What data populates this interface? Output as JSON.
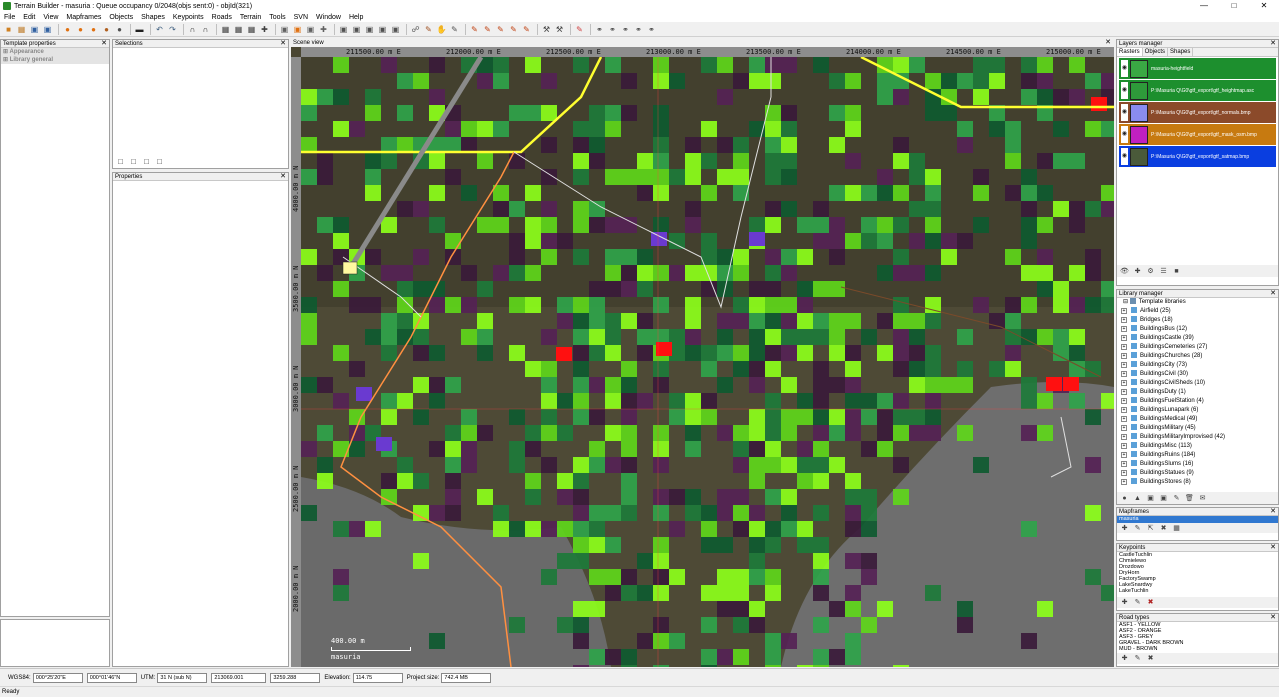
{
  "window": {
    "title": "Terrain Builder - masuria : Queue occupancy 0/2048(objs sent:0) - objId(321)"
  },
  "menu": [
    "File",
    "Edit",
    "View",
    "Mapframes",
    "Objects",
    "Shapes",
    "Keypoints",
    "Roads",
    "Terrain",
    "Tools",
    "SVN",
    "Window",
    "Help"
  ],
  "panels": {
    "template_properties": {
      "title": "Template properties",
      "rows": [
        "Appearance",
        "Library general"
      ]
    },
    "selections": {
      "title": "Selections"
    },
    "properties": {
      "title": "Properties"
    },
    "scene_view": {
      "title": "Scene view"
    },
    "layers_manager": {
      "title": "Layers manager",
      "tabs": [
        "Rasters",
        "Objects",
        "Shapes"
      ]
    },
    "library_manager": {
      "title": "Library manager"
    },
    "mapframes": {
      "title": "Mapframes",
      "selected": "masuria"
    },
    "keypoints": {
      "title": "Keypoints"
    },
    "road_types": {
      "title": "Road types"
    }
  },
  "scene": {
    "x_ticks": [
      "211500.00 m E",
      "212000.00 m E",
      "212500.00 m E",
      "213000.00 m E",
      "213500.00 m E",
      "214000.00 m E",
      "214500.00 m E",
      "215000.00 m E"
    ],
    "y_ticks": [
      "4000.00 m N",
      "3500.00 m N",
      "3000.00 m N",
      "2500.00 m N",
      "2000.00 m N"
    ],
    "scale_label": "400.00 m",
    "map_name": "masuria"
  },
  "layers": [
    {
      "label": "masuria-heightfield",
      "bg": "#1d8f2e",
      "thumb": "#3aa844"
    },
    {
      "label": "P:\\Masuria Q\\G0\\gtf_export\\gtf_heightmap.asc",
      "bg": "#1d8f2e",
      "thumb": "#2e9a3a"
    },
    {
      "label": "P:\\Masuria Q\\G0\\gtf_export\\gtf_normals.bmp",
      "bg": "#8b4a2a",
      "thumb": "#8a8cf0"
    },
    {
      "label": "P:\\Masuria Q\\G0\\gtf_export\\gtf_mask_osm.bmp",
      "bg": "#c77a10",
      "thumb": "#c020c0"
    },
    {
      "label": "P:\\Masuria Q\\G0\\gtf_export\\gtf_satmap.bmp",
      "bg": "#0a3ee0",
      "thumb": "#4a5a3a"
    }
  ],
  "library": {
    "root": "Template libraries",
    "items": [
      "Airfield (25)",
      "Bridges (18)",
      "BuildingsBus (12)",
      "BuildingsCastle (39)",
      "BuildingsCemeteries (27)",
      "BuildingsChurches (28)",
      "BuildingsCity (73)",
      "BuildingsCivil (30)",
      "BuildingsCivilSheds (10)",
      "BuildingsDuty (1)",
      "BuildingsFuelStation (4)",
      "BuildingsLunapark (6)",
      "BuildingsMedical (49)",
      "BuildingsMilitary (45)",
      "BuildingsMilitaryImprovised (42)",
      "BuildingsMisc (113)",
      "BuildingsRuins (184)",
      "BuildingsSlums (16)",
      "BuildingsStatues (9)",
      "BuildingsStores (8)"
    ]
  },
  "keypoints": [
    "CastleTuchlin",
    "Chmielewo",
    "Drozdowo",
    "DryHorn",
    "FactorySwamp",
    "LakeSnardwy",
    "LakeTuchlin"
  ],
  "road_types": [
    "ASF1 - YELLOW",
    "ASF2 - ORANGE",
    "ASF3 - GREY",
    "GRAVEL - DARK BROWN",
    "MUD - BROWN"
  ],
  "status": {
    "wgs_label": "WGS84:",
    "wgs_lon": "000°25'20\"E",
    "wgs_lat": "000°01'46\"N",
    "utm_label": "UTM:",
    "utm_zone": "31 N (sub N)",
    "utm_e": "213069.001",
    "utm_n": "3259.288",
    "elev_label": "Elevation:",
    "elev": "114.75",
    "size_label": "Project size:",
    "size": "742.4 MB",
    "ready": "Ready"
  }
}
